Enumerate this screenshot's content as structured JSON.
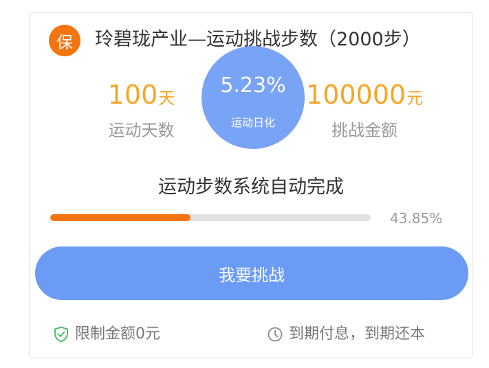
{
  "card": {
    "badge_text": "保",
    "title": "玲碧珑产业—运动挑战步数（2000步）",
    "rate": {
      "value": "5.23%",
      "label": "运动日化"
    },
    "days": {
      "number": "100",
      "unit": "天",
      "label": "运动天数"
    },
    "amount": {
      "number": "100000",
      "unit": "元",
      "label": "挑战金额"
    },
    "auto_text": "运动步数系统自动完成",
    "progress": {
      "percent_text": "43.85%",
      "fraction": 0.4385
    },
    "cta_label": "我要挑战",
    "footer": {
      "limit_text": "限制金额0元",
      "limit_icon": "shield-check-icon",
      "payout_text": "到期付息，到期还本",
      "payout_icon": "clock-icon"
    }
  },
  "colors": {
    "orange": "#f4740f",
    "gold": "#f5a623",
    "blue": "#6b9bf4",
    "green": "#4cbf6b"
  }
}
